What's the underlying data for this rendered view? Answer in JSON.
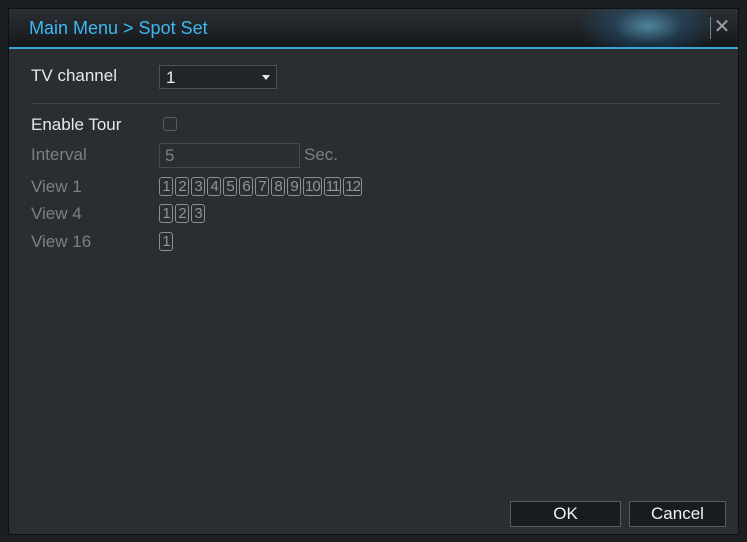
{
  "window": {
    "title": "Main Menu > Spot Set"
  },
  "tv_channel": {
    "label": "TV channel",
    "value": "1"
  },
  "enable_tour": {
    "label": "Enable Tour",
    "checked": false
  },
  "interval": {
    "label": "Interval",
    "value": "5",
    "unit": "Sec."
  },
  "view1": {
    "label": "View 1",
    "channels": [
      "1",
      "2",
      "3",
      "4",
      "5",
      "6",
      "7",
      "8",
      "9",
      "10",
      "11",
      "12"
    ]
  },
  "view4": {
    "label": "View 4",
    "channels": [
      "1",
      "2",
      "3"
    ]
  },
  "view16": {
    "label": "View 16",
    "channels": [
      "1"
    ]
  },
  "buttons": {
    "ok": "OK",
    "cancel": "Cancel"
  },
  "colors": {
    "accent": "#3fb7f2",
    "panel": "#2a2e32",
    "disabled_text": "#7b8085"
  },
  "icons": {
    "close": "close-icon",
    "dropdown": "chevron-down-icon",
    "checkbox": "checkbox-icon"
  }
}
